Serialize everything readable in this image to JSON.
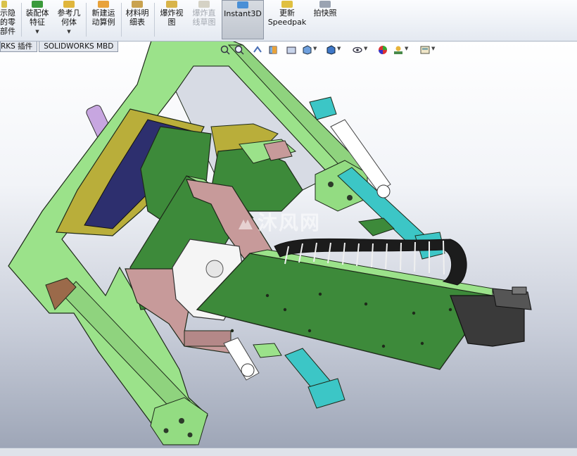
{
  "toolbar": {
    "show_hide_parts": "示隐\n的零\n部件",
    "assembly_features": "装配体\n特征",
    "reference_geometry": "参考几\n何体",
    "new_motion_study": "新建运\n动算例",
    "bill_of_materials": "材料明\n细表",
    "exploded_view": "爆炸视\n图",
    "explode_line_sketch": "爆炸直\n线草图",
    "instant3d": "Instant3D",
    "update_speedpak": "更新\nSpeedpak",
    "snapshot": "拍快照"
  },
  "tabs": [
    {
      "label": "RKS 插件"
    },
    {
      "label": "SOLIDWORKS MBD"
    }
  ],
  "view_toolbar": {
    "icons": [
      "zoom-to-fit-icon",
      "zoom-area-icon",
      "previous-view-icon",
      "section-view-icon",
      "view-orientation-icon",
      "display-style-icon",
      "hide-show-items-icon",
      "edit-appearance-icon",
      "apply-scene-icon",
      "view-settings-icon"
    ]
  },
  "watermark": {
    "text": "沐风网"
  },
  "colors": {
    "frame_green": "#9be28a",
    "plate_green": "#3d8a3a",
    "plate_pink": "#c79a9a",
    "yellow_olive": "#b9ae3a",
    "cyan": "#3cc6c6",
    "navy": "#2d2f6e",
    "motor_dark": "#3a3a3a",
    "lavender": "#c7a6e0"
  }
}
